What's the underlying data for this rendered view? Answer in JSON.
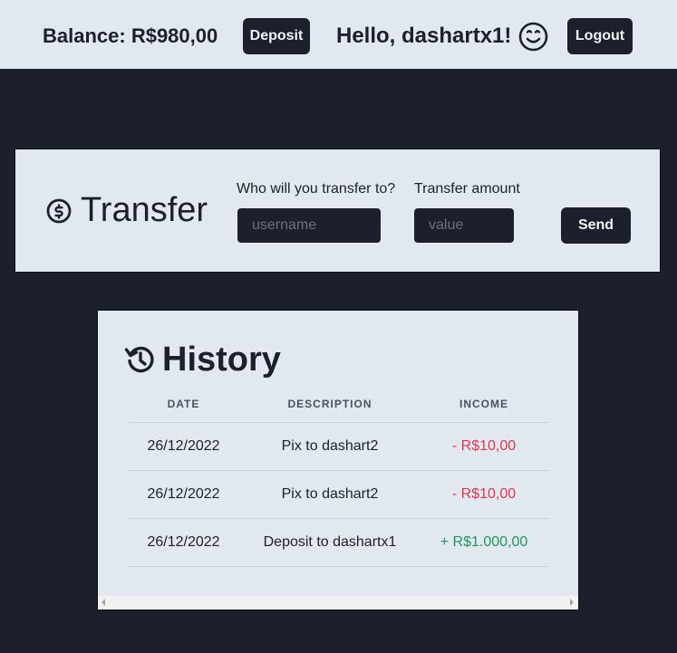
{
  "header": {
    "balance": "Balance: R$980,00",
    "deposit_label": "Deposit",
    "greeting": "Hello, dashartx1!",
    "greeting_icon": "smile-icon",
    "logout_label": "Logout"
  },
  "transfer": {
    "title": "Transfer",
    "icon": "dollar-circle-icon",
    "recipient_label": "Who will you transfer to?",
    "recipient_placeholder": "username",
    "recipient_value": "",
    "amount_label": "Transfer amount",
    "amount_placeholder": "value",
    "amount_value": "",
    "send_label": "Send"
  },
  "history": {
    "title": "History",
    "icon": "history-icon",
    "columns": [
      "DATE",
      "DESCRIPTION",
      "INCOME"
    ],
    "rows": [
      {
        "date": "26/12/2022",
        "description": "Pix to dashart2",
        "income": "- R$10,00",
        "type": "negative"
      },
      {
        "date": "26/12/2022",
        "description": "Pix to dashart2",
        "income": "- R$10,00",
        "type": "negative"
      },
      {
        "date": "26/12/2022",
        "description": "Deposit to dashartx1",
        "income": "+ R$1.000,00",
        "type": "positive"
      }
    ]
  },
  "colors": {
    "background": "#1b202c",
    "panel": "#e2e8f0",
    "negative": "#e5344f",
    "positive": "#1c9a5c"
  }
}
